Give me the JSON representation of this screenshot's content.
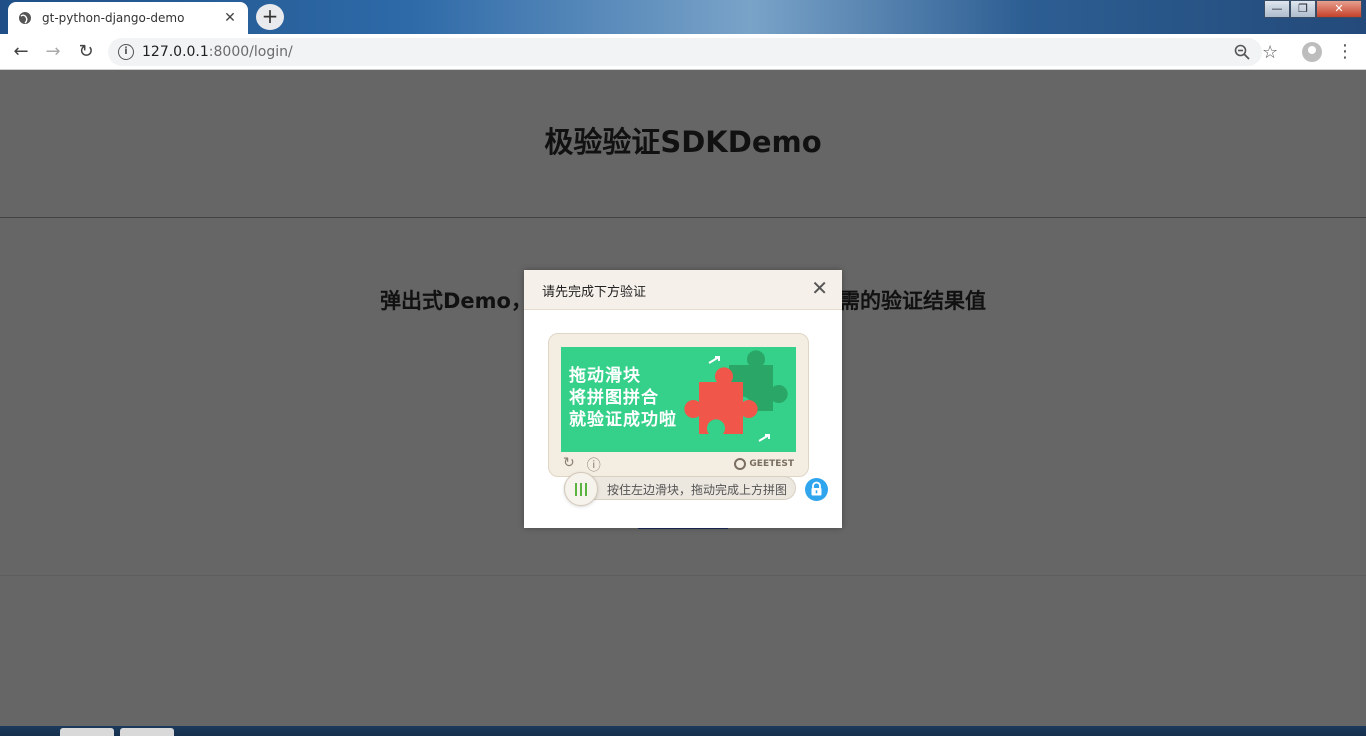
{
  "browser": {
    "tab_title": "gt-python-django-demo",
    "tab_close": "✕",
    "new_tab": "+",
    "url_host": "127.0.0.1",
    "url_path": ":8000/login/",
    "window_min": "—",
    "window_max": "❐",
    "window_close": "✕"
  },
  "page": {
    "heading": "极验验证SDKDemo",
    "subheading_left": "弹出式Demo，",
    "subheading_right": "需的验证结果值"
  },
  "modal": {
    "title": "请先完成下方验证",
    "close": "✕",
    "puzzle_lines": [
      "拖动滑块",
      "将拼图拼合",
      "就验证成功啦"
    ],
    "brand": "GEETEST",
    "slider_hint": "按住左边滑块，拖动完成上方拼图"
  },
  "colors": {
    "puzzle_bg": "#35d08a",
    "puzzle_red": "#f0574a",
    "puzzle_green": "#2aa766",
    "lock_blue": "#2fa5ee"
  }
}
